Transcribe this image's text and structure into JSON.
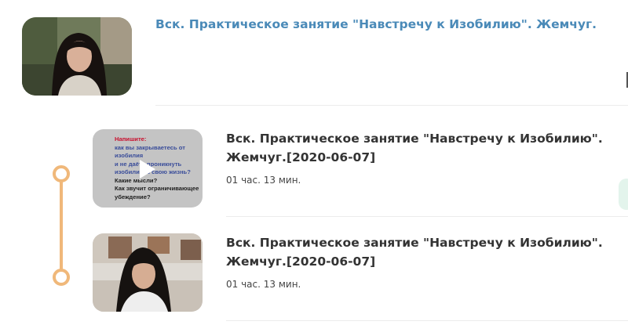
{
  "course": {
    "title": "Вск. Практическое занятие \"Навстречу к Изобилию\". Жемчуг."
  },
  "lessons": [
    {
      "title": "Вск. Практическое занятие \"Навстречу к Изобилию\". Жемчуг.[2020-06-07]",
      "duration": "01 час. 13 мин.",
      "thumb_lines": [
        "Напишите:",
        "как вы закрываетесь от",
        "изобилия",
        "и не даёте проникнуть изобилию в свою жизнь?",
        "Какие мысли?",
        "Как звучит ограничивающее",
        "убеждение?"
      ]
    },
    {
      "title": "Вск. Практическое занятие \"Навстречу к Изобилию\". Жемчуг.[2020-06-07]",
      "duration": "01 час. 13 мин."
    }
  ],
  "colors": {
    "accent_link": "#4a8ab8",
    "timeline": "#f0b87a",
    "slide_heading": "#c8102e",
    "slide_blue": "#3a4d9a"
  },
  "icons": {
    "play": "play-icon"
  }
}
